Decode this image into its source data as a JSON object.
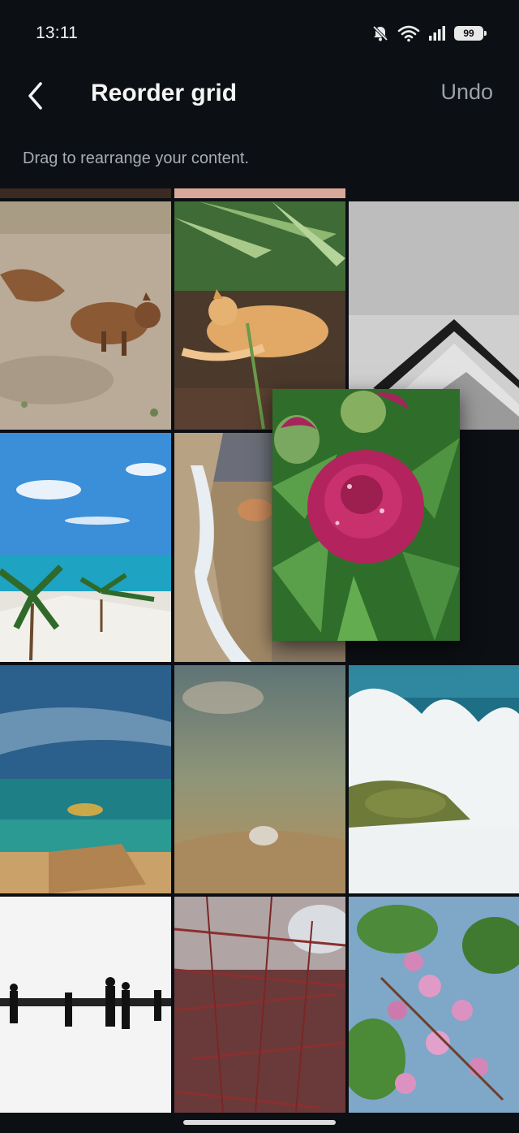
{
  "status_bar": {
    "time": "13:11",
    "battery": "99",
    "icons": [
      "bell-muted-icon",
      "wifi-icon",
      "signal-icon",
      "battery-icon"
    ]
  },
  "header": {
    "back_icon": "chevron-left-icon",
    "title": "Reorder grid",
    "undo_label": "Undo"
  },
  "subtitle": "Drag to rearrange your content.",
  "grid": {
    "tiles": [
      {
        "name": "tile-squirrel",
        "subject": "squirrel on sand"
      },
      {
        "name": "tile-cat",
        "subject": "cat sleeping in grass"
      },
      {
        "name": "tile-architecture",
        "subject": "white building corner"
      },
      {
        "name": "tile-beach-palms",
        "subject": "beach with palm trees"
      },
      {
        "name": "tile-shoreline",
        "subject": "shoreline waves"
      },
      {
        "name": "tile-empty-slot",
        "subject": "empty drop slot"
      },
      {
        "name": "tile-sea-rock",
        "subject": "sea with rocky shore"
      },
      {
        "name": "tile-shell",
        "subject": "shell on rock"
      },
      {
        "name": "tile-wave-splash",
        "subject": "wave splashing on rock"
      },
      {
        "name": "tile-people-snow",
        "subject": "people on snow"
      },
      {
        "name": "tile-dried-branches",
        "subject": "dried red branches"
      },
      {
        "name": "tile-pink-blossoms",
        "subject": "pink blossoms"
      }
    ],
    "dragging": {
      "name": "dragging-tile-peony",
      "subject": "pink peony bud"
    }
  },
  "colors": {
    "background": "#0c0f14",
    "title": "#f5f5f5",
    "undo": "#9aa1aa",
    "subtitle": "#a7adb5"
  }
}
